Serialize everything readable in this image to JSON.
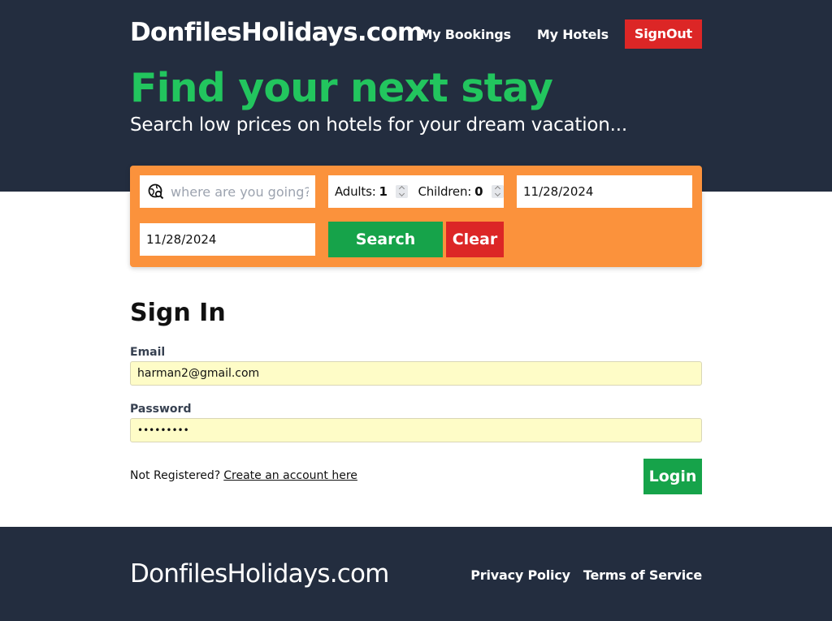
{
  "header": {
    "brand": "DonfilesHolidays.com",
    "nav": {
      "my_bookings": "My Bookings",
      "my_hotels": "My Hotels",
      "signout": "SignOut"
    }
  },
  "hero": {
    "title": "Find your next stay",
    "subtitle": "Search low prices on hotels for your dream vacation..."
  },
  "search": {
    "destination_placeholder": "where are you going?",
    "destination_value": "",
    "adults_label": "Adults:",
    "adults_value": "1",
    "children_label": "Children:",
    "children_value": "0",
    "check_in": "11/28/2024",
    "check_out": "11/28/2024",
    "search_button": "Search",
    "clear_button": "Clear",
    "icon": "globe-search-icon"
  },
  "signin": {
    "title": "Sign In",
    "email_label": "Email",
    "email_value": "harman2@gmail.com",
    "password_label": "Password",
    "password_value": "•••••••••",
    "not_registered": "Not Registered?",
    "create_account_link": "Create an account here",
    "login_button": "Login"
  },
  "footer": {
    "brand": "DonfilesHolidays.com",
    "privacy": "Privacy Policy",
    "terms": "Terms of Service"
  },
  "colors": {
    "header_bg": "#232d3f",
    "hero_title": "#22c55e",
    "search_panel": "#fb923c",
    "primary_button": "#16a34a",
    "danger_button": "#dc2626",
    "field_bg": "#fefcc7"
  }
}
